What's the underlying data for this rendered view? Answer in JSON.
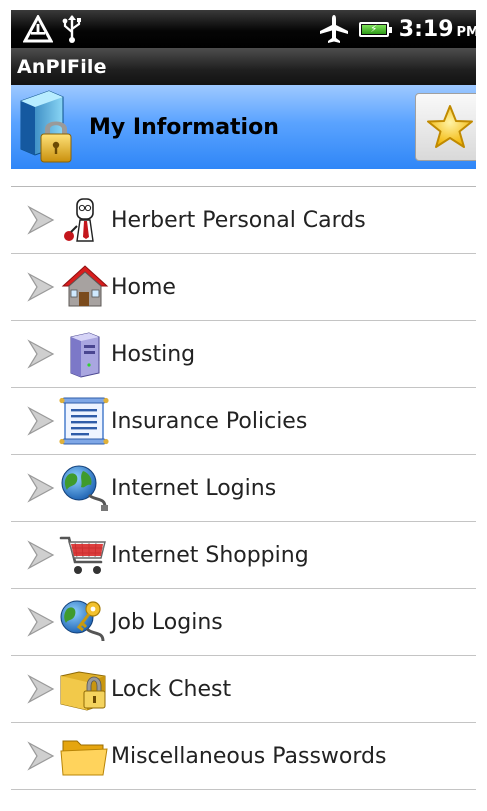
{
  "status_bar": {
    "time": "3:19",
    "ampm": "PM",
    "icons": [
      "alert-triangle-icon",
      "usb-icon",
      "airplane-mode-icon",
      "battery-charging-icon"
    ]
  },
  "app": {
    "title": "AnPIFile"
  },
  "header": {
    "title": "My Information",
    "icon": "lock-file-icon",
    "favorite_icon": "star-icon"
  },
  "list": {
    "items": [
      {
        "label": "Herbert Personal Cards",
        "icon": "person-cartoon-icon"
      },
      {
        "label": "Home",
        "icon": "house-icon"
      },
      {
        "label": "Hosting",
        "icon": "server-icon"
      },
      {
        "label": "Insurance Policies",
        "icon": "scroll-document-icon"
      },
      {
        "label": "Internet Logins",
        "icon": "globe-cable-icon"
      },
      {
        "label": "Internet Shopping",
        "icon": "shopping-cart-icon"
      },
      {
        "label": "Job Logins",
        "icon": "globe-key-icon"
      },
      {
        "label": "Lock Chest",
        "icon": "padlock-icon"
      },
      {
        "label": "Miscellaneous Passwords",
        "icon": "folder-icon"
      }
    ]
  },
  "colors": {
    "header_blue": "#2f86f7",
    "status_black": "#000000",
    "star_yellow": "#f6c21a"
  }
}
